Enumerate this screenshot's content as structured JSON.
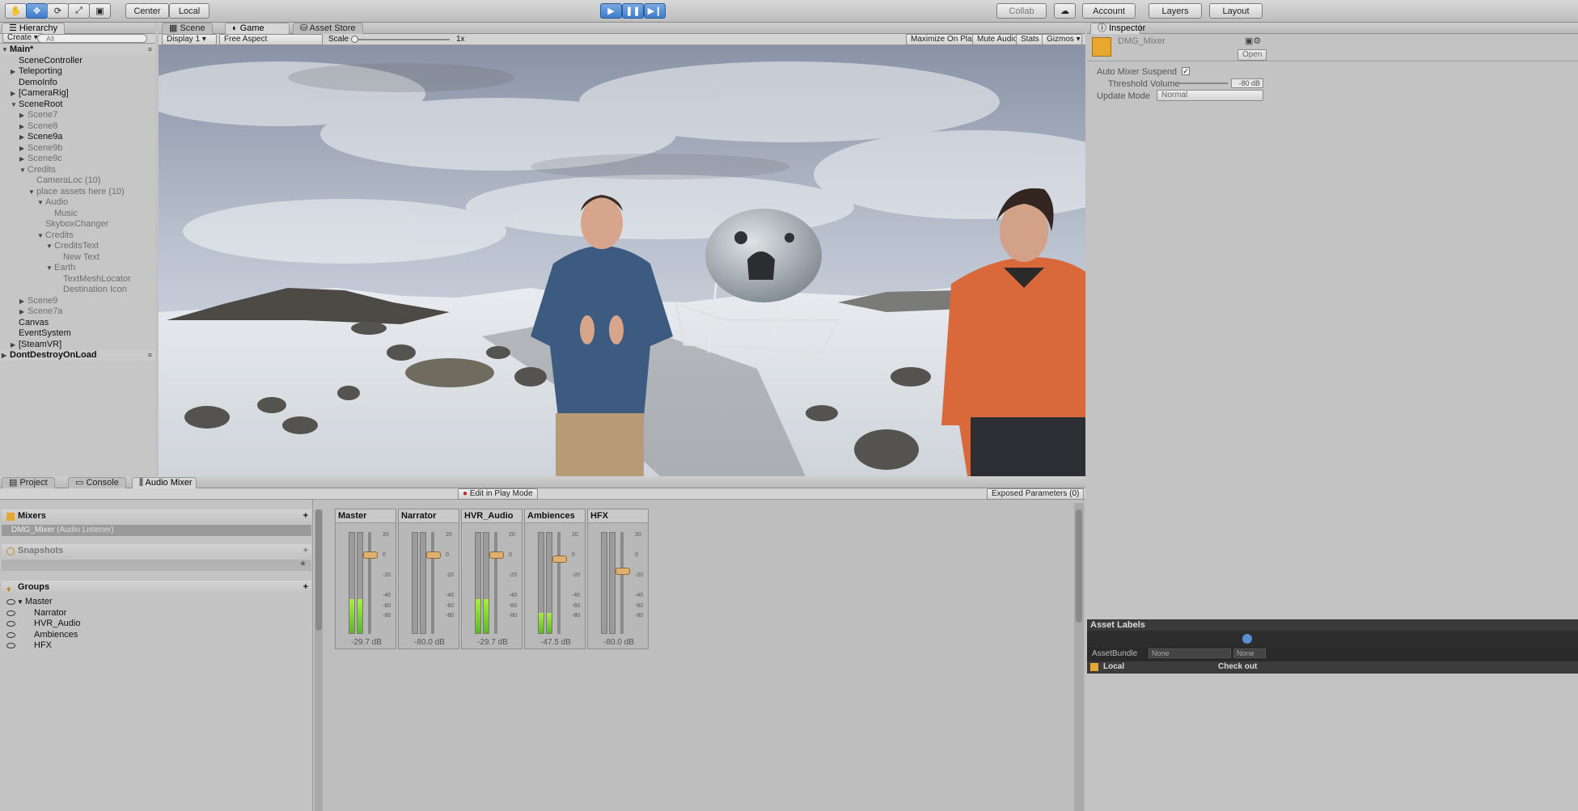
{
  "toolbar": {
    "tools": [
      "hand-icon",
      "move-icon",
      "rotate-icon",
      "scale-icon",
      "rect-icon"
    ],
    "pivot": "Center",
    "space": "Local",
    "collab": "Collab",
    "account": "Account",
    "layers": "Layers",
    "layout": "Layout"
  },
  "hierarchy": {
    "tab": "Hierarchy",
    "create": "Create",
    "search_placeholder": "All",
    "items": [
      {
        "label": "Main*",
        "indent": 0,
        "arrow": "down",
        "style": "scene"
      },
      {
        "label": "SceneController",
        "indent": 1,
        "arrow": "",
        "style": ""
      },
      {
        "label": "Teleporting",
        "indent": 1,
        "arrow": "right",
        "style": ""
      },
      {
        "label": "DemoInfo",
        "indent": 1,
        "arrow": "",
        "style": ""
      },
      {
        "label": "[CameraRig]",
        "indent": 1,
        "arrow": "right",
        "style": ""
      },
      {
        "label": "SceneRoot",
        "indent": 1,
        "arrow": "down",
        "style": ""
      },
      {
        "label": "Scene7",
        "indent": 2,
        "arrow": "right",
        "style": "gray"
      },
      {
        "label": "Scene8",
        "indent": 2,
        "arrow": "right",
        "style": "gray"
      },
      {
        "label": "Scene9a",
        "indent": 2,
        "arrow": "right",
        "style": ""
      },
      {
        "label": "Scene9b",
        "indent": 2,
        "arrow": "right",
        "style": "gray"
      },
      {
        "label": "Scene9c",
        "indent": 2,
        "arrow": "right",
        "style": "gray"
      },
      {
        "label": "Credits",
        "indent": 2,
        "arrow": "down",
        "style": "gray"
      },
      {
        "label": "CameraLoc (10)",
        "indent": 3,
        "arrow": "",
        "style": "gray"
      },
      {
        "label": "place assets here (10)",
        "indent": 3,
        "arrow": "down",
        "style": "gray"
      },
      {
        "label": "Audio",
        "indent": 4,
        "arrow": "down",
        "style": "gray"
      },
      {
        "label": "Music",
        "indent": 5,
        "arrow": "",
        "style": "gray"
      },
      {
        "label": "SkyboxChanger",
        "indent": 4,
        "arrow": "",
        "style": "gray"
      },
      {
        "label": "Credits",
        "indent": 4,
        "arrow": "down",
        "style": "gray"
      },
      {
        "label": "CreditsText",
        "indent": 5,
        "arrow": "down",
        "style": "gray"
      },
      {
        "label": "New Text",
        "indent": 6,
        "arrow": "",
        "style": "gray"
      },
      {
        "label": "Earth",
        "indent": 5,
        "arrow": "down",
        "style": "gray"
      },
      {
        "label": "TextMeshLocator",
        "indent": 6,
        "arrow": "",
        "style": "gray"
      },
      {
        "label": "Destination Icon",
        "indent": 6,
        "arrow": "",
        "style": "gray"
      },
      {
        "label": "Scene9",
        "indent": 2,
        "arrow": "right",
        "style": "gray"
      },
      {
        "label": "Scene7a",
        "indent": 2,
        "arrow": "right",
        "style": "gray"
      },
      {
        "label": "Canvas",
        "indent": 1,
        "arrow": "",
        "style": ""
      },
      {
        "label": "EventSystem",
        "indent": 1,
        "arrow": "",
        "style": ""
      },
      {
        "label": "[SteamVR]",
        "indent": 1,
        "arrow": "right",
        "style": ""
      },
      {
        "label": "DontDestroyOnLoad",
        "indent": 0,
        "arrow": "right",
        "style": "scene"
      }
    ]
  },
  "center_tabs": {
    "scene": "Scene",
    "game": "Game",
    "asset_store": "Asset Store"
  },
  "game_bar": {
    "display": "Display 1",
    "aspect": "Free Aspect",
    "scale_label": "Scale",
    "scale_value": "1x",
    "maximize": "Maximize On Play",
    "mute": "Mute Audio",
    "stats": "Stats",
    "gizmos": "Gizmos"
  },
  "inspector": {
    "tab": "Inspector",
    "object_name": "DMG_Mixer",
    "open": "Open",
    "auto_suspend_label": "Auto Mixer Suspend",
    "threshold_label": "Threshold Volume",
    "threshold_value": "-80 dB",
    "update_mode_label": "Update Mode",
    "update_mode_value": "Normal",
    "asset_labels": "Asset Labels",
    "asset_bundle": "AssetBundle",
    "asset_bundle_value": "None",
    "asset_bundle_variant": "None",
    "local": "Local",
    "check_out": "Check out"
  },
  "bottom_tabs": {
    "project": "Project",
    "console": "Console",
    "audio_mixer": "Audio Mixer"
  },
  "mixer": {
    "edit_play_mode": "Edit in Play Mode",
    "exposed": "Exposed Parameters (0)",
    "mixers_title": "Mixers",
    "mixer_item": "DMG_Mixer",
    "mixer_item_note": "(Audio Listener)",
    "snapshots_title": "Snapshots",
    "groups_title": "Groups",
    "groups": [
      {
        "label": "Master",
        "indent": 0
      },
      {
        "label": "Narrator",
        "indent": 1
      },
      {
        "label": "HVR_Audio",
        "indent": 1
      },
      {
        "label": "Ambiences",
        "indent": 1
      },
      {
        "label": "HFX",
        "indent": 1
      }
    ],
    "strips": [
      {
        "name": "Master",
        "db": "-29.7 dB",
        "level": 0.34,
        "knob": 0.22
      },
      {
        "name": "Narrator",
        "db": "-80.0 dB",
        "level": 0,
        "knob": 0.22
      },
      {
        "name": "HVR_Audio",
        "db": "-29.7 dB",
        "level": 0.34,
        "knob": 0.22
      },
      {
        "name": "Ambiences",
        "db": "-47.5 dB",
        "level": 0.2,
        "knob": 0.26
      },
      {
        "name": "HFX",
        "db": "-80.0 dB",
        "level": 0,
        "knob": 0.38
      }
    ],
    "scale": [
      "20",
      "",
      "0",
      "",
      "-20",
      "",
      "-40",
      "-60",
      "-80"
    ]
  },
  "colors": {
    "accent": "#3e7ccc",
    "level": "#8fe03a",
    "knob": "#e0b070"
  }
}
